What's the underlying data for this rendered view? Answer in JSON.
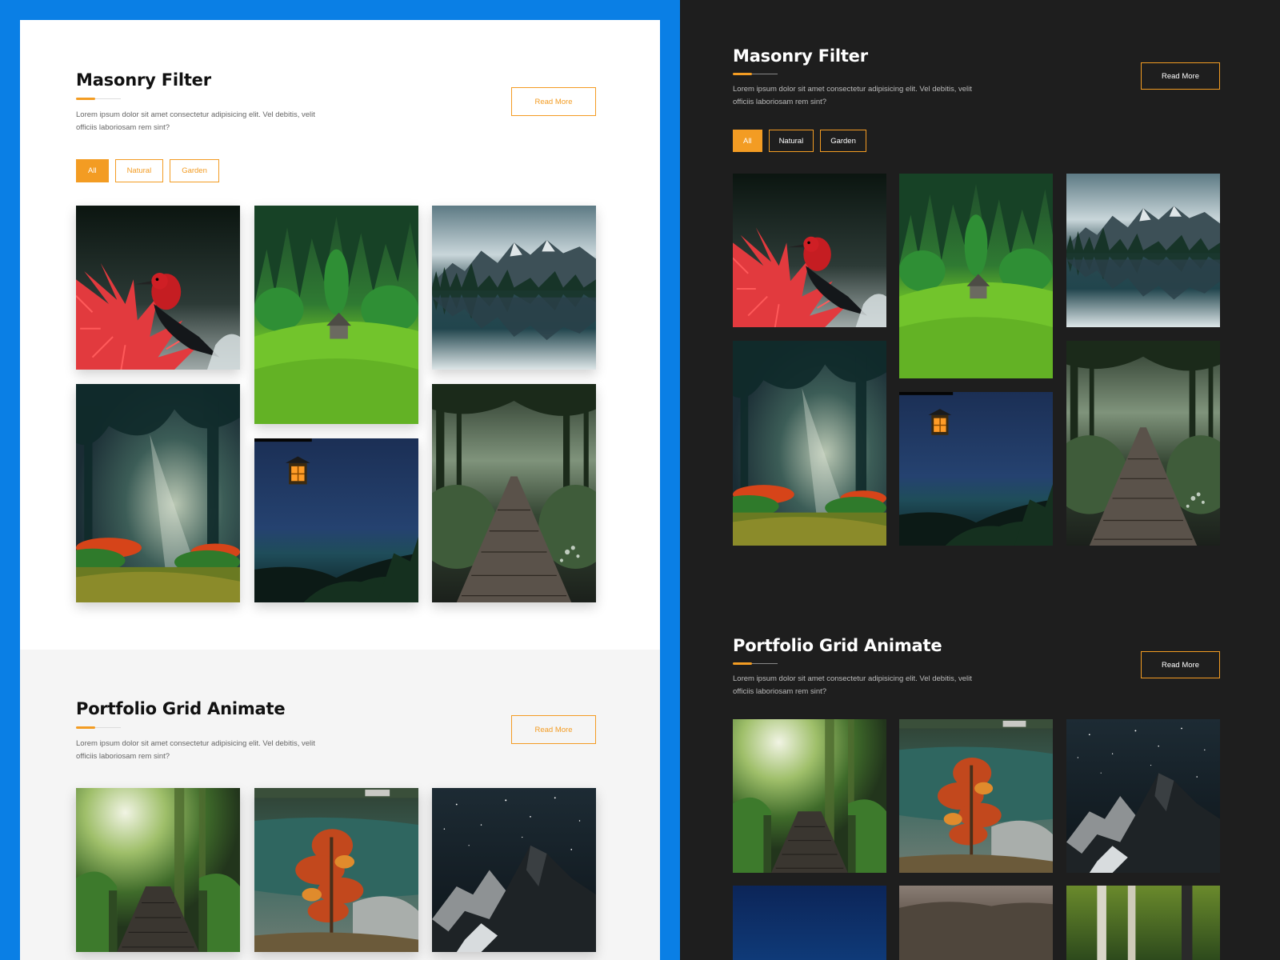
{
  "light": {
    "masonry": {
      "title": "Masonry Filter",
      "description": "Lorem ipsum dolor sit amet consectetur adipisicing elit. Vel debitis, velit officiis laboriosam rem sint?",
      "read_more": "Read More",
      "filters": [
        "All",
        "Natural",
        "Garden"
      ],
      "active_filter": "All"
    },
    "portfolio": {
      "title": "Portfolio Grid Animate",
      "description": "Lorem ipsum dolor sit amet consectetur adipisicing elit. Vel debitis, velit officiis laboriosam rem sint?",
      "read_more": "Read More"
    }
  },
  "dark": {
    "masonry": {
      "title": "Masonry Filter",
      "description": "Lorem ipsum dolor sit amet consectetur adipisicing elit. Vel debitis, velit officiis laboriosam rem sint?",
      "read_more": "Read More",
      "filters": [
        "All",
        "Natural",
        "Garden"
      ],
      "active_filter": "All"
    },
    "portfolio": {
      "title": "Portfolio Grid Animate",
      "description": "Lorem ipsum dolor sit amet consectetur adipisicing elit. Vel debitis, velit officiis laboriosam rem sint?",
      "read_more": "Read More"
    }
  },
  "colors": {
    "accent": "#f39c23",
    "frame_blue": "#0a7fe5",
    "dark_bg": "#1e1e1e",
    "light_bg": "#ffffff",
    "light_grey_bg": "#f5f5f5"
  },
  "images": {
    "masonry": [
      "red-bird-flower-image",
      "green-meadow-cabin-image",
      "mountain-lake-reflection-image",
      "sunlit-forest-image",
      "night-lantern-image",
      "forest-bridge-image"
    ],
    "portfolio": [
      "forest-walkway-image",
      "autumn-tree-lake-image",
      "starry-mountain-image",
      "night-sky-image",
      "hills-image",
      "birch-forest-image"
    ]
  }
}
